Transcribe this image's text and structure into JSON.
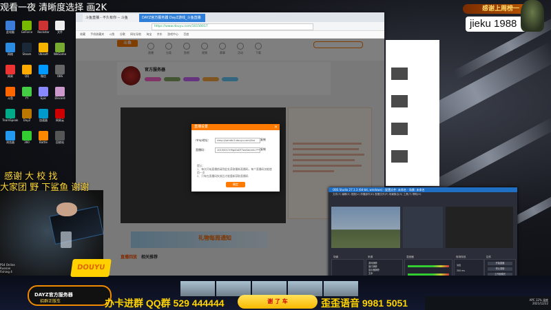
{
  "overlay": {
    "top_text": "观看一夜 清晰度选择 画2K",
    "chat_line1": "感谢 大 校 找",
    "chat_line2": "大家团 野 下鲨鱼 谢谢"
  },
  "thanks_box": {
    "header": "感谢上周榜一",
    "name": "jieku 1988"
  },
  "browser": {
    "tabs": [
      "斗鱼直播 - 不久有你 -- 斗鱼",
      "DAYZ官方服务器 DayZ游戏_斗鱼直播"
    ],
    "url": "https://www.douyu.com/10150017",
    "bookmarks": [
      "收藏",
      "手机收藏夹",
      "斗鱼",
      "谷歌",
      "网址导航",
      "淘宝",
      "京东",
      "游戏中心",
      "百度"
    ],
    "room_name": "官方服务器",
    "nav_items": [
      "直播",
      "分类",
      "鱼吧",
      "视频",
      "赛事",
      "活动",
      "下载"
    ],
    "banner_text": "礼物每周通知",
    "related_tab1": "直播回放",
    "related_tab2": "相关推荐",
    "notice": "直播画面将展示在观看人数中，请注意不要泄露个人信息"
  },
  "dialog": {
    "title": "直播设置",
    "rtmp_label": "rtmp地址：",
    "rtmp_value": "rtmp://sendtc3.douyu.com/live",
    "code_label": "直播码：",
    "code_value": "10150017rMgiZaDT?wsSecret=********",
    "copy_label": "复制",
    "tip_label": "提示：",
    "note1": "1、每次开始直播前请到此处获取最新直播码，每个直播码仅能使用一次",
    "note2": "2、只有在直播码失效后才能重新获取直播码",
    "button": "确定"
  },
  "obs": {
    "title": "OBS Studio 27.1.3 (64-bit, windows) - 配置文件: 未命名 - 场景: 未命名",
    "menu": [
      "文件(F)",
      "编辑(E)",
      "视图(V)",
      "停靠部件(D)",
      "配置文件(P)",
      "场景集合(S)",
      "工具(T)",
      "帮助(H)"
    ],
    "docks": [
      "场景",
      "来源",
      "混音器",
      "转场特效",
      "控件"
    ],
    "sources": [
      "游戏捕获",
      "窗口捕获",
      "显示器捕获",
      "文本",
      "图像",
      "音频输入",
      "图像幻灯片"
    ],
    "controls": [
      "开始直播",
      "停止录制",
      "工作室模式",
      "设置",
      "退出"
    ],
    "transition": "淡出",
    "duration": "300 ms"
  },
  "camera": {
    "label1": "PS4 Online",
    "label2": "Russian",
    "label3": "Fishing 4"
  },
  "bottom": {
    "pill_line1": "DAYZ官方服务器",
    "pill_line2": "招群正版车",
    "logo": "DOUYU",
    "promo1": "办卡进群 QQ群 529 444444",
    "gift": "谢 了 车",
    "promo2": "歪歪语音 9981 5051",
    "tray_line1": "APC 12% 温度",
    "tray_line2": "2021/12/22"
  },
  "colors": {
    "accent": "#ff7a00",
    "promo_yellow": "#ffd400",
    "obs_bg": "#2b2e38"
  }
}
